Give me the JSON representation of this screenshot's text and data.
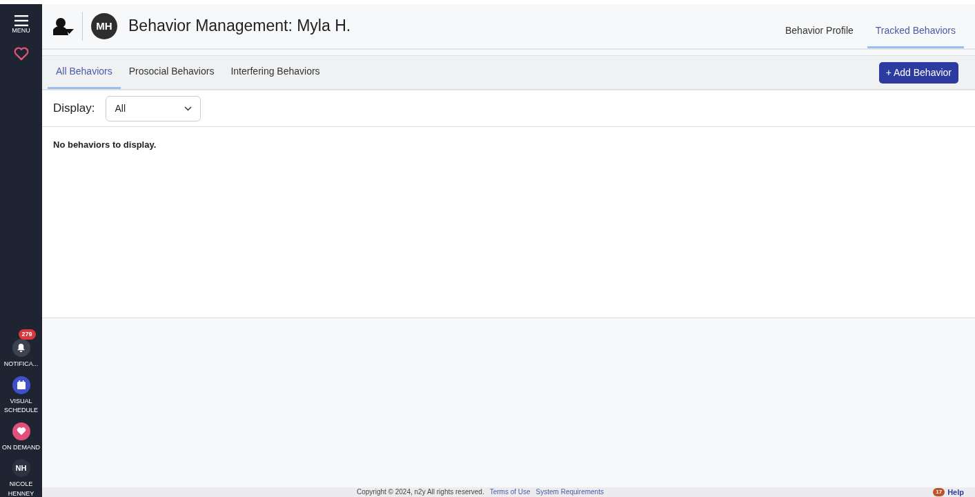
{
  "sidebar": {
    "menu_label": "MENU",
    "bottom_items": [
      {
        "kind": "notifications",
        "label": "NOTIFICA...",
        "badge": "279"
      },
      {
        "kind": "schedule",
        "label": "VISUAL SCHEDULE"
      },
      {
        "kind": "ondemand",
        "label": "ON DEMAND"
      },
      {
        "kind": "user",
        "initials": "NH",
        "label": "NICOLE HENNEY"
      }
    ]
  },
  "header": {
    "avatar_initials": "MH",
    "title": "Behavior Management: Myla H.",
    "tabs": [
      {
        "label": "Behavior Profile",
        "selected": false
      },
      {
        "label": "Tracked Behaviors",
        "selected": true
      }
    ]
  },
  "subtabs": [
    {
      "label": "All Behaviors",
      "selected": true
    },
    {
      "label": "Prosocial Behaviors",
      "selected": false
    },
    {
      "label": "Interfering Behaviors",
      "selected": false
    }
  ],
  "add_button": "+ Add Behavior",
  "display_filter": {
    "label": "Display:",
    "value": "All"
  },
  "empty_message": "No behaviors to display.",
  "footer": {
    "copyright": "Copyright © 2024, n2y All rights reserved.",
    "links": [
      "Terms of Use",
      "System Requirements"
    ],
    "help_badge": "17",
    "help": "Help"
  }
}
